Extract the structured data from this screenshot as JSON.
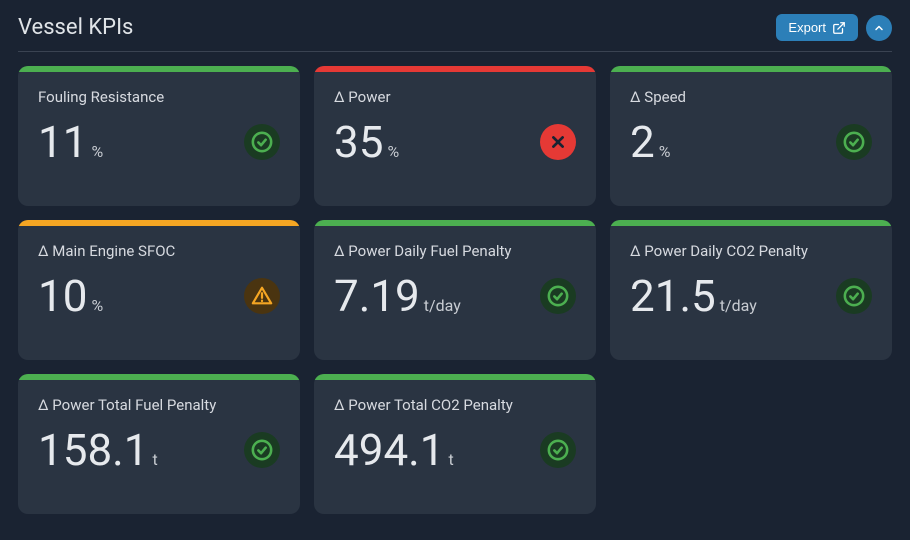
{
  "header": {
    "title": "Vessel KPIs",
    "export_label": "Export"
  },
  "colors": {
    "green": "#4caf50",
    "red": "#e53935",
    "orange": "#f5a623"
  },
  "cards": [
    {
      "label": "Fouling Resistance",
      "value": "11",
      "unit": "%",
      "status": "ok",
      "bar": "green"
    },
    {
      "label": "Δ Power",
      "value": "35",
      "unit": "%",
      "status": "err",
      "bar": "red"
    },
    {
      "label": "Δ Speed",
      "value": "2",
      "unit": "%",
      "status": "ok",
      "bar": "green"
    },
    {
      "label": "Δ Main Engine SFOC",
      "value": "10",
      "unit": "%",
      "status": "warn",
      "bar": "orange"
    },
    {
      "label": "Δ Power Daily Fuel Penalty",
      "value": "7.19",
      "unit": "t/day",
      "status": "ok",
      "bar": "green"
    },
    {
      "label": "Δ Power Daily CO2 Penalty",
      "value": "21.5",
      "unit": "t/day",
      "status": "ok",
      "bar": "green"
    },
    {
      "label": "Δ Power Total Fuel Penalty",
      "value": "158.1",
      "unit": "t",
      "status": "ok",
      "bar": "green"
    },
    {
      "label": "Δ Power Total CO2 Penalty",
      "value": "494.1",
      "unit": "t",
      "status": "ok",
      "bar": "green"
    }
  ]
}
